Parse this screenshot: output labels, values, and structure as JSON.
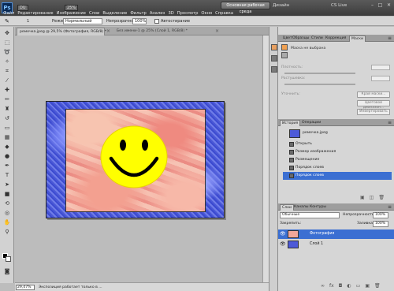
{
  "app": {
    "logo": "Ps",
    "mini_left": "DU",
    "mini_zoom": "25%",
    "workspace": "Основная рабочая среда",
    "design": "Дизайн",
    "cslive": "CS Live",
    "min": "–",
    "max": "□",
    "close": "✕"
  },
  "menu": [
    "Файл",
    "Редактирование",
    "Изображение",
    "Слои",
    "Выделение",
    "Фильтр",
    "Анализ",
    "3D",
    "Просмотр",
    "Окно",
    "Справка"
  ],
  "options": {
    "size": "1",
    "mode_label": "Режим:",
    "mode_value": "Нормальный",
    "opacity_label": "Непрозрачность:",
    "opacity_value": "100%",
    "auto_erase": "Автостирание"
  },
  "documents": {
    "active_tab": "ремечка.jpeg @ 29,5% (Фотография, RGB/8) *",
    "inactive_tab": "Без имени-1 @ 25% (Слой 1, RGB/8) *",
    "close": "×"
  },
  "status": {
    "zoom": "29,47%",
    "text": "Экспозиция работает только в ..."
  },
  "panels": {
    "top_tabs": [
      "Цвет",
      "Образцы",
      "Стили",
      "Коррекция",
      "Маски"
    ],
    "masks": {
      "title": "Маска не выбрана",
      "density": "Плотность:",
      "feather": "Растушевка:",
      "refine": "Уточнить:",
      "mask_edge": "Край маски...",
      "color_range": "Цветовой диапазон...",
      "invert": "Инвертировать"
    },
    "history_tabs": [
      "История",
      "Операции"
    ],
    "history_snapshot": "ремечка.jpeg",
    "history_items": [
      "Открыть",
      "Размер изображения",
      "Размещение",
      "Порядок слоев",
      "Порядок слоев"
    ],
    "layers_tabs": [
      "Слои",
      "Каналы",
      "Контуры"
    ],
    "blend_mode": "Обычные",
    "opacity_label": "Непрозрачность:",
    "opacity_value": "100%",
    "lock_label": "Закрепить:",
    "fill_label": "Заливка:",
    "fill_value": "100%",
    "layers": [
      "Фотография",
      "Слой 1"
    ]
  }
}
